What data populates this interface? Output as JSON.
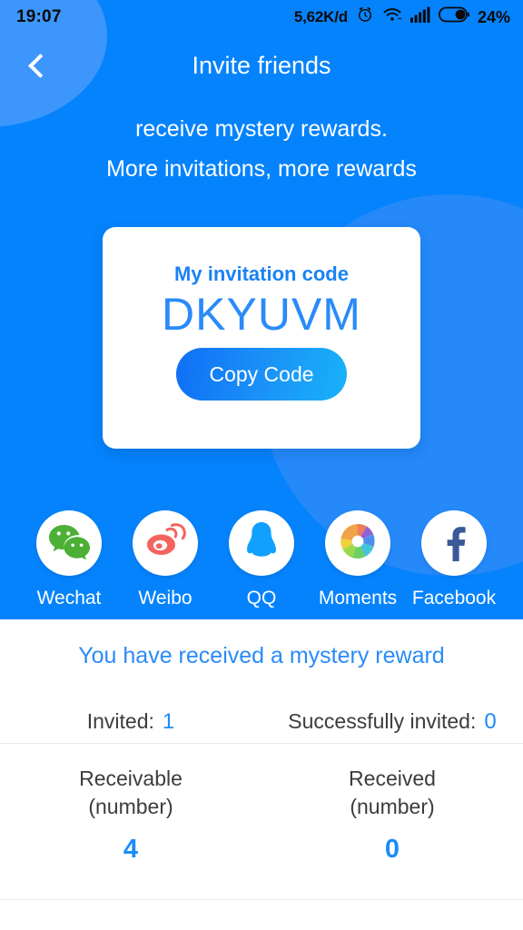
{
  "statusbar": {
    "time": "19:07",
    "network_speed": "5,62K/d",
    "alarm_icon": "alarm-clock-icon",
    "wifi_icon": "wifi-icon",
    "signal_icon": "signal-bars-icon",
    "battery_icon": "battery-icon",
    "battery_percent": "24%"
  },
  "header": {
    "back_icon": "back-chevron-icon",
    "title": "Invite friends"
  },
  "hero": {
    "subtitle_line1": "receive mystery rewards.",
    "subtitle_line2": "More invitations, more rewards",
    "background_color": "#0583fc",
    "accent_blob_color": "#2589fa"
  },
  "card": {
    "label": "My invitation code",
    "code": "DKYUVM",
    "copy_button": "Copy Code",
    "copy_button_gradient_from": "#0f6ff5",
    "copy_button_gradient_to": "#19b2f9",
    "code_color": "#2a8bf8"
  },
  "share": {
    "items": [
      {
        "label": "Wechat",
        "icon": "wechat-icon",
        "color": "#4caf36"
      },
      {
        "label": "Weibo",
        "icon": "weibo-icon",
        "color": "#f4645f"
      },
      {
        "label": "QQ",
        "icon": "qq-icon",
        "color": "#12a0ff"
      },
      {
        "label": "Moments",
        "icon": "moments-aperture-icon",
        "color": "#f08a3c"
      },
      {
        "label": "Facebook",
        "icon": "facebook-icon",
        "color": "#3b5998"
      }
    ]
  },
  "bottom": {
    "reward_message": "You have received a mystery reward",
    "invited_label": "Invited:",
    "invited_value": "1",
    "successfully_invited_label": "Successfully invited:",
    "successfully_invited_value": "0",
    "stats": [
      {
        "line1": "Receivable",
        "line2": "(number)",
        "value": "4"
      },
      {
        "line1": "Received",
        "line2": "(number)",
        "value": "0"
      }
    ],
    "accent_color": "#1a8cf8"
  }
}
